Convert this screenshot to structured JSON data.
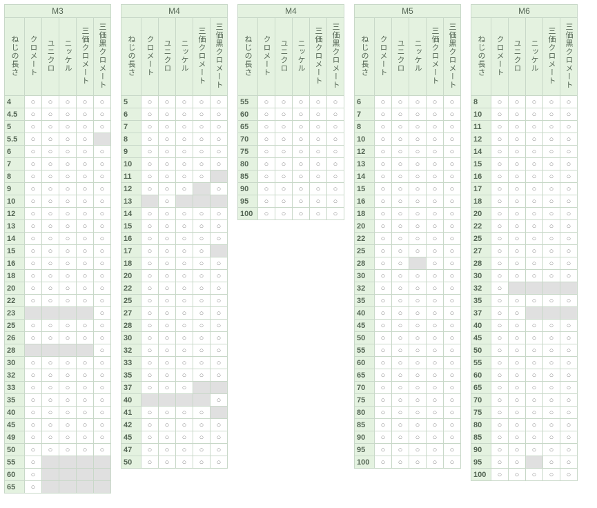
{
  "mark": "○",
  "columns": [
    "ねじの長さ",
    "クロメート",
    "ユニクロ",
    "ニッケル",
    "三価クロメート",
    "三価黒クロメート"
  ],
  "tables": [
    {
      "title": "M3",
      "rows": [
        {
          "l": "4",
          "c": [
            1,
            1,
            1,
            1,
            1
          ]
        },
        {
          "l": "4.5",
          "c": [
            1,
            1,
            1,
            1,
            1
          ]
        },
        {
          "l": "5",
          "c": [
            1,
            1,
            1,
            1,
            1
          ]
        },
        {
          "l": "5.5",
          "c": [
            1,
            1,
            1,
            1,
            0
          ]
        },
        {
          "l": "6",
          "c": [
            1,
            1,
            1,
            1,
            1
          ]
        },
        {
          "l": "7",
          "c": [
            1,
            1,
            1,
            1,
            1
          ]
        },
        {
          "l": "8",
          "c": [
            1,
            1,
            1,
            1,
            1
          ]
        },
        {
          "l": "9",
          "c": [
            1,
            1,
            1,
            1,
            1
          ]
        },
        {
          "l": "10",
          "c": [
            1,
            1,
            1,
            1,
            1
          ]
        },
        {
          "l": "12",
          "c": [
            1,
            1,
            1,
            1,
            1
          ]
        },
        {
          "l": "13",
          "c": [
            1,
            1,
            1,
            1,
            1
          ]
        },
        {
          "l": "14",
          "c": [
            1,
            1,
            1,
            1,
            1
          ]
        },
        {
          "l": "15",
          "c": [
            1,
            1,
            1,
            1,
            1
          ]
        },
        {
          "l": "16",
          "c": [
            1,
            1,
            1,
            1,
            1
          ]
        },
        {
          "l": "18",
          "c": [
            1,
            1,
            1,
            1,
            1
          ]
        },
        {
          "l": "20",
          "c": [
            1,
            1,
            1,
            1,
            1
          ]
        },
        {
          "l": "22",
          "c": [
            1,
            1,
            1,
            1,
            1
          ]
        },
        {
          "l": "23",
          "c": [
            0,
            0,
            0,
            0,
            1
          ]
        },
        {
          "l": "25",
          "c": [
            1,
            1,
            1,
            1,
            1
          ]
        },
        {
          "l": "26",
          "c": [
            1,
            1,
            1,
            1,
            1
          ]
        },
        {
          "l": "28",
          "c": [
            0,
            0,
            0,
            0,
            1
          ]
        },
        {
          "l": "30",
          "c": [
            1,
            1,
            1,
            1,
            1
          ]
        },
        {
          "l": "32",
          "c": [
            1,
            1,
            1,
            1,
            1
          ]
        },
        {
          "l": "33",
          "c": [
            1,
            1,
            1,
            1,
            1
          ]
        },
        {
          "l": "35",
          "c": [
            1,
            1,
            1,
            1,
            1
          ]
        },
        {
          "l": "40",
          "c": [
            1,
            1,
            1,
            1,
            1
          ]
        },
        {
          "l": "45",
          "c": [
            1,
            1,
            1,
            1,
            1
          ]
        },
        {
          "l": "49",
          "c": [
            1,
            1,
            1,
            1,
            1
          ]
        },
        {
          "l": "50",
          "c": [
            1,
            1,
            1,
            1,
            1
          ]
        },
        {
          "l": "55",
          "c": [
            1,
            0,
            0,
            0,
            0
          ]
        },
        {
          "l": "60",
          "c": [
            1,
            0,
            0,
            0,
            0
          ]
        },
        {
          "l": "65",
          "c": [
            1,
            0,
            0,
            0,
            0
          ]
        }
      ]
    },
    {
      "title": "M4",
      "rows": [
        {
          "l": "5",
          "c": [
            1,
            1,
            1,
            1,
            1
          ]
        },
        {
          "l": "6",
          "c": [
            1,
            1,
            1,
            1,
            1
          ]
        },
        {
          "l": "7",
          "c": [
            1,
            1,
            1,
            1,
            1
          ]
        },
        {
          "l": "8",
          "c": [
            1,
            1,
            1,
            1,
            1
          ]
        },
        {
          "l": "9",
          "c": [
            1,
            1,
            1,
            1,
            1
          ]
        },
        {
          "l": "10",
          "c": [
            1,
            1,
            1,
            1,
            1
          ]
        },
        {
          "l": "11",
          "c": [
            1,
            1,
            1,
            1,
            0
          ]
        },
        {
          "l": "12",
          "c": [
            1,
            1,
            1,
            0,
            1
          ]
        },
        {
          "l": "13",
          "c": [
            0,
            1,
            0,
            0,
            0
          ]
        },
        {
          "l": "14",
          "c": [
            1,
            1,
            1,
            1,
            1
          ]
        },
        {
          "l": "15",
          "c": [
            1,
            1,
            1,
            1,
            1
          ]
        },
        {
          "l": "16",
          "c": [
            1,
            1,
            1,
            1,
            1
          ]
        },
        {
          "l": "17",
          "c": [
            1,
            1,
            1,
            1,
            0
          ]
        },
        {
          "l": "18",
          "c": [
            1,
            1,
            1,
            1,
            1
          ]
        },
        {
          "l": "20",
          "c": [
            1,
            1,
            1,
            1,
            1
          ]
        },
        {
          "l": "22",
          "c": [
            1,
            1,
            1,
            1,
            1
          ]
        },
        {
          "l": "25",
          "c": [
            1,
            1,
            1,
            1,
            1
          ]
        },
        {
          "l": "27",
          "c": [
            1,
            1,
            1,
            1,
            1
          ]
        },
        {
          "l": "28",
          "c": [
            1,
            1,
            1,
            1,
            1
          ]
        },
        {
          "l": "30",
          "c": [
            1,
            1,
            1,
            1,
            1
          ]
        },
        {
          "l": "32",
          "c": [
            1,
            1,
            1,
            1,
            1
          ]
        },
        {
          "l": "33",
          "c": [
            1,
            1,
            1,
            1,
            1
          ]
        },
        {
          "l": "35",
          "c": [
            1,
            1,
            1,
            1,
            1
          ]
        },
        {
          "l": "37",
          "c": [
            1,
            1,
            1,
            0,
            0
          ]
        },
        {
          "l": "40",
          "c": [
            0,
            0,
            0,
            0,
            1
          ]
        },
        {
          "l": "41",
          "c": [
            1,
            1,
            1,
            1,
            0
          ]
        },
        {
          "l": "42",
          "c": [
            1,
            1,
            1,
            1,
            1
          ]
        },
        {
          "l": "45",
          "c": [
            1,
            1,
            1,
            1,
            1
          ]
        },
        {
          "l": "47",
          "c": [
            1,
            1,
            1,
            1,
            1
          ]
        },
        {
          "l": "50",
          "c": [
            1,
            1,
            1,
            1,
            1
          ]
        }
      ]
    },
    {
      "title": "M4",
      "rows": [
        {
          "l": "55",
          "c": [
            1,
            1,
            1,
            1,
            1
          ]
        },
        {
          "l": "60",
          "c": [
            1,
            1,
            1,
            1,
            1
          ]
        },
        {
          "l": "65",
          "c": [
            1,
            1,
            1,
            1,
            1
          ]
        },
        {
          "l": "70",
          "c": [
            1,
            1,
            1,
            1,
            1
          ]
        },
        {
          "l": "75",
          "c": [
            1,
            1,
            1,
            1,
            1
          ]
        },
        {
          "l": "80",
          "c": [
            1,
            1,
            1,
            1,
            1
          ]
        },
        {
          "l": "85",
          "c": [
            1,
            1,
            1,
            1,
            1
          ]
        },
        {
          "l": "90",
          "c": [
            1,
            1,
            1,
            1,
            1
          ]
        },
        {
          "l": "95",
          "c": [
            1,
            1,
            1,
            1,
            1
          ]
        },
        {
          "l": "100",
          "c": [
            1,
            1,
            1,
            1,
            1
          ]
        }
      ]
    },
    {
      "title": "M5",
      "rows": [
        {
          "l": "6",
          "c": [
            1,
            1,
            1,
            1,
            1
          ]
        },
        {
          "l": "7",
          "c": [
            1,
            1,
            1,
            1,
            1
          ]
        },
        {
          "l": "8",
          "c": [
            1,
            1,
            1,
            1,
            1
          ]
        },
        {
          "l": "10",
          "c": [
            1,
            1,
            1,
            1,
            1
          ]
        },
        {
          "l": "12",
          "c": [
            1,
            1,
            1,
            1,
            1
          ]
        },
        {
          "l": "13",
          "c": [
            1,
            1,
            1,
            1,
            1
          ]
        },
        {
          "l": "14",
          "c": [
            1,
            1,
            1,
            1,
            1
          ]
        },
        {
          "l": "15",
          "c": [
            1,
            1,
            1,
            1,
            1
          ]
        },
        {
          "l": "16",
          "c": [
            1,
            1,
            1,
            1,
            1
          ]
        },
        {
          "l": "18",
          "c": [
            1,
            1,
            1,
            1,
            1
          ]
        },
        {
          "l": "20",
          "c": [
            1,
            1,
            1,
            1,
            1
          ]
        },
        {
          "l": "22",
          "c": [
            1,
            1,
            1,
            1,
            1
          ]
        },
        {
          "l": "25",
          "c": [
            1,
            1,
            1,
            1,
            1
          ]
        },
        {
          "l": "28",
          "c": [
            1,
            1,
            0,
            1,
            1
          ]
        },
        {
          "l": "30",
          "c": [
            1,
            1,
            1,
            1,
            1
          ]
        },
        {
          "l": "32",
          "c": [
            1,
            1,
            1,
            1,
            1
          ]
        },
        {
          "l": "35",
          "c": [
            1,
            1,
            1,
            1,
            1
          ]
        },
        {
          "l": "40",
          "c": [
            1,
            1,
            1,
            1,
            1
          ]
        },
        {
          "l": "45",
          "c": [
            1,
            1,
            1,
            1,
            1
          ]
        },
        {
          "l": "50",
          "c": [
            1,
            1,
            1,
            1,
            1
          ]
        },
        {
          "l": "55",
          "c": [
            1,
            1,
            1,
            1,
            1
          ]
        },
        {
          "l": "60",
          "c": [
            1,
            1,
            1,
            1,
            1
          ]
        },
        {
          "l": "65",
          "c": [
            1,
            1,
            1,
            1,
            1
          ]
        },
        {
          "l": "70",
          "c": [
            1,
            1,
            1,
            1,
            1
          ]
        },
        {
          "l": "75",
          "c": [
            1,
            1,
            1,
            1,
            1
          ]
        },
        {
          "l": "80",
          "c": [
            1,
            1,
            1,
            1,
            1
          ]
        },
        {
          "l": "85",
          "c": [
            1,
            1,
            1,
            1,
            1
          ]
        },
        {
          "l": "90",
          "c": [
            1,
            1,
            1,
            1,
            1
          ]
        },
        {
          "l": "95",
          "c": [
            1,
            1,
            1,
            1,
            1
          ]
        },
        {
          "l": "100",
          "c": [
            1,
            1,
            1,
            1,
            1
          ]
        }
      ]
    },
    {
      "title": "M6",
      "rows": [
        {
          "l": "8",
          "c": [
            1,
            1,
            1,
            1,
            1
          ]
        },
        {
          "l": "10",
          "c": [
            1,
            1,
            1,
            1,
            1
          ]
        },
        {
          "l": "11",
          "c": [
            1,
            1,
            1,
            1,
            1
          ]
        },
        {
          "l": "12",
          "c": [
            1,
            1,
            1,
            1,
            1
          ]
        },
        {
          "l": "14",
          "c": [
            1,
            1,
            1,
            1,
            1
          ]
        },
        {
          "l": "15",
          "c": [
            1,
            1,
            1,
            1,
            1
          ]
        },
        {
          "l": "16",
          "c": [
            1,
            1,
            1,
            1,
            1
          ]
        },
        {
          "l": "17",
          "c": [
            1,
            1,
            1,
            1,
            1
          ]
        },
        {
          "l": "18",
          "c": [
            1,
            1,
            1,
            1,
            1
          ]
        },
        {
          "l": "20",
          "c": [
            1,
            1,
            1,
            1,
            1
          ]
        },
        {
          "l": "22",
          "c": [
            1,
            1,
            1,
            1,
            1
          ]
        },
        {
          "l": "25",
          "c": [
            1,
            1,
            1,
            1,
            1
          ]
        },
        {
          "l": "27",
          "c": [
            1,
            1,
            1,
            1,
            1
          ]
        },
        {
          "l": "28",
          "c": [
            1,
            1,
            1,
            1,
            1
          ]
        },
        {
          "l": "30",
          "c": [
            1,
            1,
            1,
            1,
            1
          ]
        },
        {
          "l": "32",
          "c": [
            1,
            0,
            0,
            0,
            0
          ]
        },
        {
          "l": "35",
          "c": [
            1,
            1,
            1,
            1,
            1
          ]
        },
        {
          "l": "37",
          "c": [
            1,
            1,
            0,
            0,
            0
          ]
        },
        {
          "l": "40",
          "c": [
            1,
            1,
            1,
            1,
            1
          ]
        },
        {
          "l": "45",
          "c": [
            1,
            1,
            1,
            1,
            1
          ]
        },
        {
          "l": "50",
          "c": [
            1,
            1,
            1,
            1,
            1
          ]
        },
        {
          "l": "55",
          "c": [
            1,
            1,
            1,
            1,
            1
          ]
        },
        {
          "l": "60",
          "c": [
            1,
            1,
            1,
            1,
            1
          ]
        },
        {
          "l": "65",
          "c": [
            1,
            1,
            1,
            1,
            1
          ]
        },
        {
          "l": "70",
          "c": [
            1,
            1,
            1,
            1,
            1
          ]
        },
        {
          "l": "75",
          "c": [
            1,
            1,
            1,
            1,
            1
          ]
        },
        {
          "l": "80",
          "c": [
            1,
            1,
            1,
            1,
            1
          ]
        },
        {
          "l": "85",
          "c": [
            1,
            1,
            1,
            1,
            1
          ]
        },
        {
          "l": "90",
          "c": [
            1,
            1,
            1,
            1,
            1
          ]
        },
        {
          "l": "95",
          "c": [
            1,
            1,
            0,
            1,
            1
          ]
        },
        {
          "l": "100",
          "c": [
            1,
            1,
            1,
            1,
            1
          ]
        }
      ]
    }
  ]
}
